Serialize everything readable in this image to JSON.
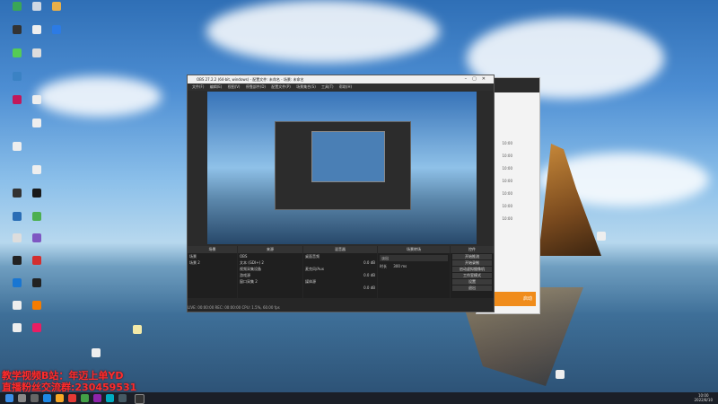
{
  "watermark": {
    "line1": "教学视频B站：年迈上单YD",
    "line2": "直播粉丝交流群:230459531"
  },
  "obs": {
    "title": "OBS 27.2.2 (64-bit, windows) - 配置文件: 未命名 - 场景: 未命名",
    "menu": [
      "文件(F)",
      "编辑(E)",
      "视图(V)",
      "停靠部件(D)",
      "配置文件(P)",
      "场景集合(S)",
      "工具(T)",
      "帮助(H)"
    ],
    "tabs": [
      "场景",
      "来源",
      "混音器",
      "场景转场",
      "控件"
    ],
    "scenes": [
      "场景",
      "场景 2"
    ],
    "sources": [
      "OBS",
      "文本 (GDI+) 2",
      "视频采集设备",
      "游戏源",
      "窗口采集 2"
    ],
    "mixer": [
      {
        "name": "桌面音频",
        "value": "0.0 dB"
      },
      {
        "name": "麦克风/Aux",
        "value": "0.0 dB"
      },
      {
        "name": "媒体源",
        "value": "0.0 dB"
      }
    ],
    "transition": {
      "type": "淡出",
      "duration_label": "时长",
      "duration": "300 ms"
    },
    "controls": [
      "开始推流",
      "开始录制",
      "启动虚拟摄像机",
      "工作室模式",
      "设置",
      "退出"
    ],
    "status": "LIVE: 00:00:00   REC: 00:00:00   CPU: 1.5%, 60.00 fps"
  },
  "bg_window": {
    "button": "启动",
    "times": [
      "10:00",
      "10:00",
      "10:00",
      "10:00",
      "10:00",
      "10:00",
      "10:00"
    ]
  },
  "taskbar": {
    "time": "10:00",
    "date": "2022/8/10"
  }
}
